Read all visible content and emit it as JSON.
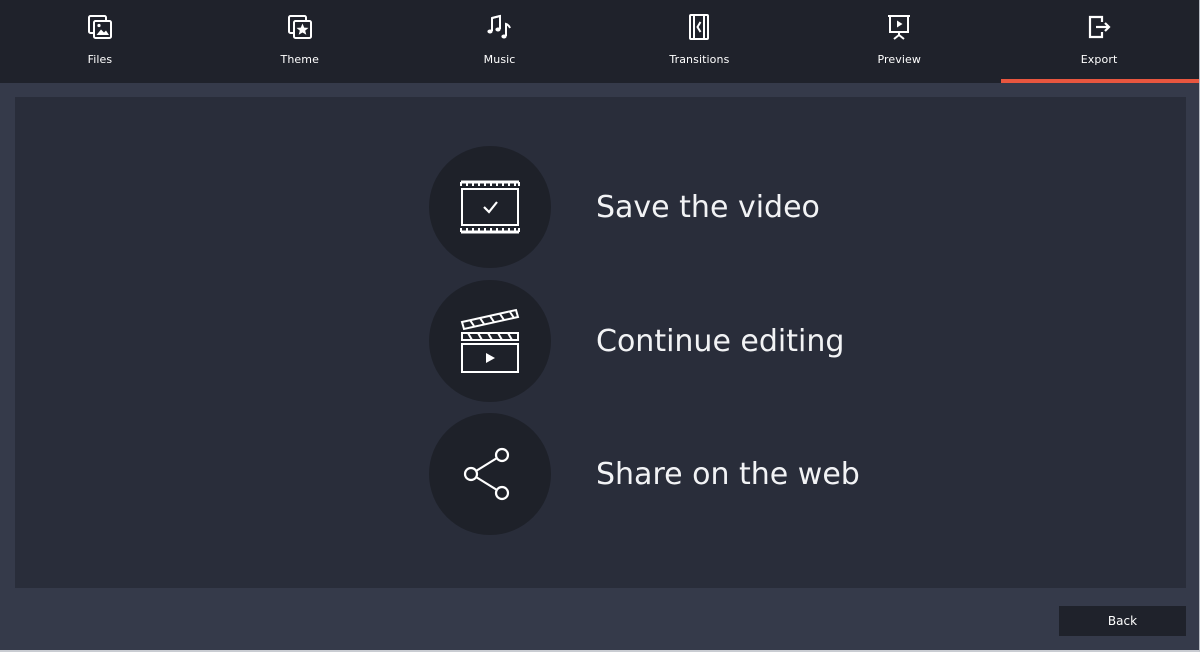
{
  "colors": {
    "accent": "#e8563f",
    "tabbar_bg": "#1f222b",
    "window_bg": "#353a4a",
    "panel_bg": "#292d3a",
    "circle_bg": "#1e2129",
    "text": "#ffffff"
  },
  "tabs": [
    {
      "label": "Files",
      "icon": "files-icon",
      "active": false
    },
    {
      "label": "Theme",
      "icon": "theme-icon",
      "active": false
    },
    {
      "label": "Music",
      "icon": "music-icon",
      "active": false
    },
    {
      "label": "Transitions",
      "icon": "transitions-icon",
      "active": false
    },
    {
      "label": "Preview",
      "icon": "preview-icon",
      "active": false
    },
    {
      "label": "Export",
      "icon": "export-icon",
      "active": true
    }
  ],
  "export_options": [
    {
      "label": "Save the video",
      "icon": "save-video-icon"
    },
    {
      "label": "Continue editing",
      "icon": "clapperboard-icon"
    },
    {
      "label": "Share on the web",
      "icon": "share-icon"
    }
  ],
  "footer": {
    "back_label": "Back"
  }
}
